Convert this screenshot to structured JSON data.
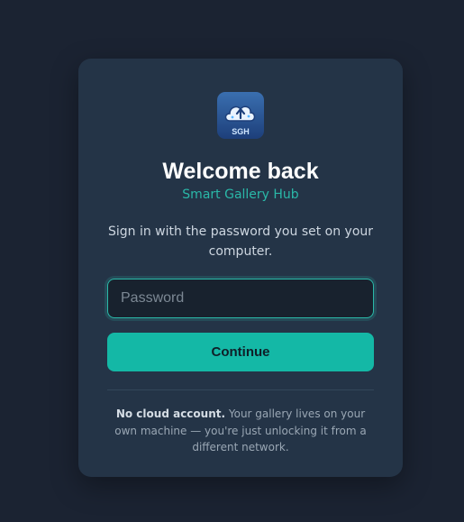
{
  "login": {
    "logo_text": "SGH",
    "title": "Welcome back",
    "subtitle": "Smart Gallery Hub",
    "description": "Sign in with the password you set on your computer.",
    "password_placeholder": "Password",
    "continue_label": "Continue",
    "note_bold": "No cloud account.",
    "note_text": " Your gallery lives on your own machine — you're just unlocking it from a different network."
  },
  "colors": {
    "page_background": "#1b2332",
    "card_background": "#243447",
    "accent": "#14b8a6",
    "subtitle": "#2ab8a8"
  },
  "icons": {
    "logo": "cloud-upload-icon"
  }
}
